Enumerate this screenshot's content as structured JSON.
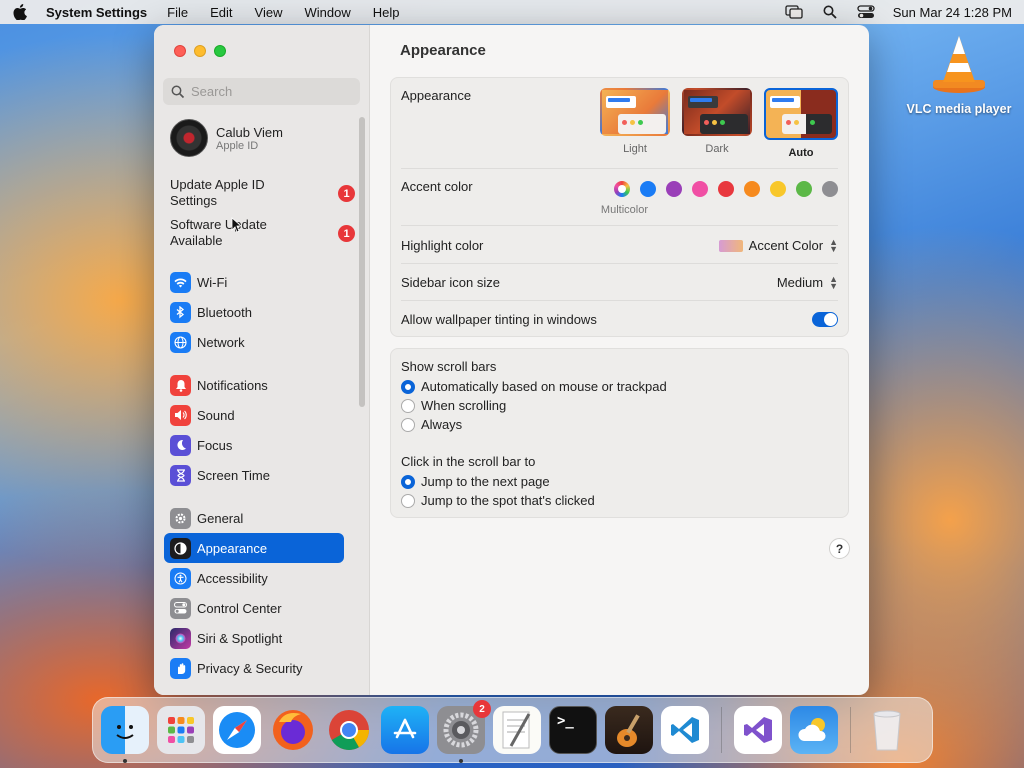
{
  "menubar": {
    "app_name": "System Settings",
    "menus": [
      "File",
      "Edit",
      "View",
      "Window",
      "Help"
    ],
    "datetime": "Sun Mar 24  1:28 PM"
  },
  "desktop": {
    "icon_label": "VLC media player"
  },
  "sidebar": {
    "search_placeholder": "Search",
    "account": {
      "name": "Calub Viem",
      "sub": "Apple ID"
    },
    "notices": [
      {
        "label": "Update Apple ID Settings",
        "badge": "1"
      },
      {
        "label": "Software Update Available",
        "badge": "1"
      }
    ],
    "items": [
      {
        "label": "Wi-Fi",
        "icon": "wifi-icon",
        "color": "#1a7cf5"
      },
      {
        "label": "Bluetooth",
        "icon": "bluetooth-icon",
        "color": "#1a7cf5"
      },
      {
        "label": "Network",
        "icon": "globe-icon",
        "color": "#1a7cf5"
      },
      {
        "label": "Notifications",
        "icon": "bell-icon",
        "color": "#f0423c"
      },
      {
        "label": "Sound",
        "icon": "speaker-icon",
        "color": "#f0423c"
      },
      {
        "label": "Focus",
        "icon": "moon-icon",
        "color": "#5a4fd6"
      },
      {
        "label": "Screen Time",
        "icon": "hourglass-icon",
        "color": "#5a4fd6"
      },
      {
        "label": "General",
        "icon": "gear-icon",
        "color": "#8e8e92"
      },
      {
        "label": "Appearance",
        "icon": "appearance-icon",
        "color": "#1c1c1e"
      },
      {
        "label": "Accessibility",
        "icon": "accessibility-icon",
        "color": "#1a7cf5"
      },
      {
        "label": "Control Center",
        "icon": "control-center-icon",
        "color": "#8e8e92"
      },
      {
        "label": "Siri & Spotlight",
        "icon": "siri-icon",
        "color": "#c23aa6"
      },
      {
        "label": "Privacy & Security",
        "icon": "hand-icon",
        "color": "#1a7cf5"
      }
    ],
    "active_item": "Appearance"
  },
  "main": {
    "title": "Appearance",
    "appearance": {
      "label": "Appearance",
      "options": [
        {
          "label": "Light",
          "selected": false
        },
        {
          "label": "Dark",
          "selected": false
        },
        {
          "label": "Auto",
          "selected": true
        }
      ]
    },
    "accent": {
      "label": "Accent color",
      "colors": [
        "multicolor",
        "#1a7cf5",
        "#9a3fb8",
        "#f04fa4",
        "#e8383e",
        "#f68a1e",
        "#f8c72a",
        "#5cb847",
        "#8e8e92"
      ],
      "selected_caption": "Multicolor"
    },
    "highlight": {
      "label": "Highlight color",
      "value": "Accent Color"
    },
    "sidebar_icon_size": {
      "label": "Sidebar icon size",
      "value": "Medium"
    },
    "wallpaper_tinting": {
      "label": "Allow wallpaper tinting in windows",
      "enabled": true
    },
    "scroll_bars": {
      "label": "Show scroll bars",
      "options": [
        "Automatically based on mouse or trackpad",
        "When scrolling",
        "Always"
      ],
      "selected": 0
    },
    "click_scroll": {
      "label": "Click in the scroll bar to",
      "options": [
        "Jump to the next page",
        "Jump to the spot that's clicked"
      ],
      "selected": 0
    },
    "help": "?"
  },
  "dock": {
    "apps": [
      "Finder",
      "Launchpad",
      "Safari",
      "Firefox",
      "Chrome",
      "App Store",
      "System Settings",
      "TextEdit",
      "Terminal",
      "GarageBand",
      "Visual Studio Code",
      "Visual Studio",
      "Weather",
      "Trash"
    ],
    "settings_badge": "2"
  }
}
